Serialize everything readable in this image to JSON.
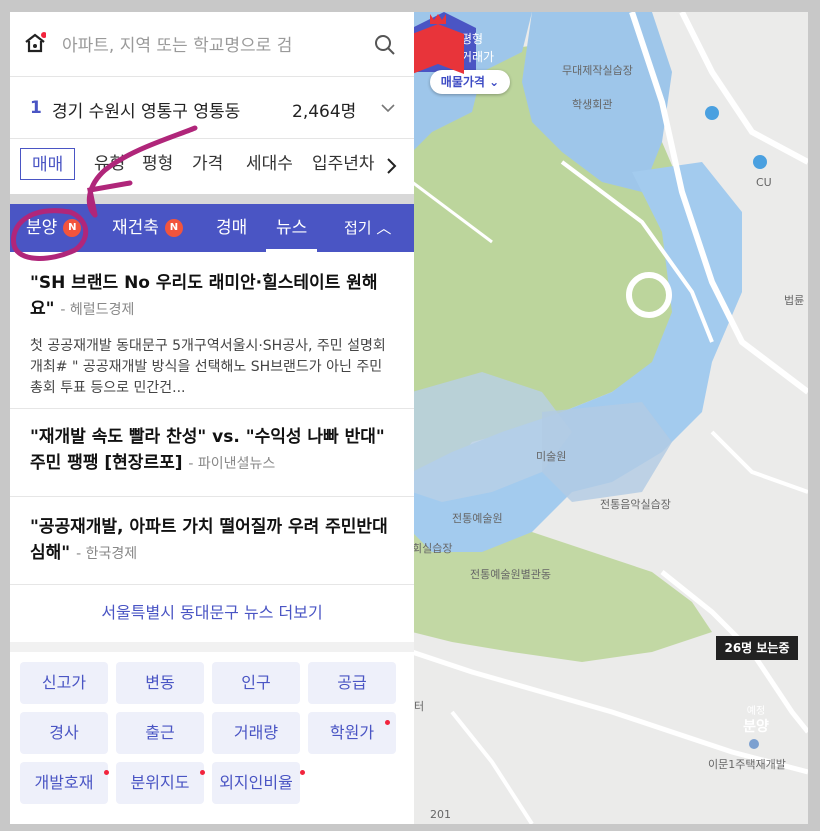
{
  "search": {
    "placeholder": "아파트, 지역 또는 학교명으로 검"
  },
  "region": {
    "rank": "1",
    "name": "경기 수원시 영통구 영통동",
    "count": "2,464명"
  },
  "filters": [
    "매매",
    "유형",
    "평형",
    "가격",
    "세대수",
    "입주년차"
  ],
  "tabs": {
    "bunyang": "분양",
    "redevelop": "재건축",
    "auction": "경매",
    "news": "뉴스",
    "fold": "접기",
    "badge": "N"
  },
  "news": [
    {
      "title": "\"SH 브랜드 No 우리도 래미안·힐스테이트 원해요\"",
      "source": "- 헤럴드경제",
      "snippet": "첫 공공재개발 동대문구 5개구역서울시·SH공사, 주민 설명회 개최# \" 공공재개발 방식을 선택해노 SH브랜드가 아닌 주민 총회 투표 등으로 민간건..."
    },
    {
      "title": "\"재개발 속도 빨라 찬성\" vs. \"수익성 나빠 반대\" 주민 팽팽 [현장르포]",
      "source": "- 파이낸셜뉴스"
    },
    {
      "title": "\"공공재개발, 아파트 가치 떨어질까 우려 주민반대 심해\"",
      "source": "- 한국경제"
    }
  ],
  "more_link": "서울특별시 동대문구 뉴스 더보기",
  "grid": [
    {
      "label": "신고가",
      "dot": false
    },
    {
      "label": "변동",
      "dot": false
    },
    {
      "label": "인구",
      "dot": false
    },
    {
      "label": "공급",
      "dot": false
    },
    {
      "label": "경사",
      "dot": false
    },
    {
      "label": "출근",
      "dot": false
    },
    {
      "label": "거래량",
      "dot": false
    },
    {
      "label": "학원가",
      "dot": true
    },
    {
      "label": "개발호재",
      "dot": true
    },
    {
      "label": "분위지도",
      "dot": true
    },
    {
      "label": "외지인비율",
      "dot": true
    }
  ],
  "map": {
    "pin_top": "평형",
    "pin_bottom": "실거래가",
    "price_pill": "매물가격",
    "labels": [
      "무대제작실습장",
      "학생회관",
      "CU",
      "법륜",
      "미술원",
      "전통음악실습장",
      "전통예술원",
      "전통예술원별관동",
      "회실습장",
      "이문1주택재개발",
      "201",
      "터"
    ],
    "viewers": "26명 보는중",
    "sale_top": "예정",
    "sale_main": "분양"
  },
  "colors": {
    "accent": "#4a55c4",
    "badge_red": "#f2543d",
    "sale_red": "#e8343a",
    "annotation": "#b0267a"
  }
}
